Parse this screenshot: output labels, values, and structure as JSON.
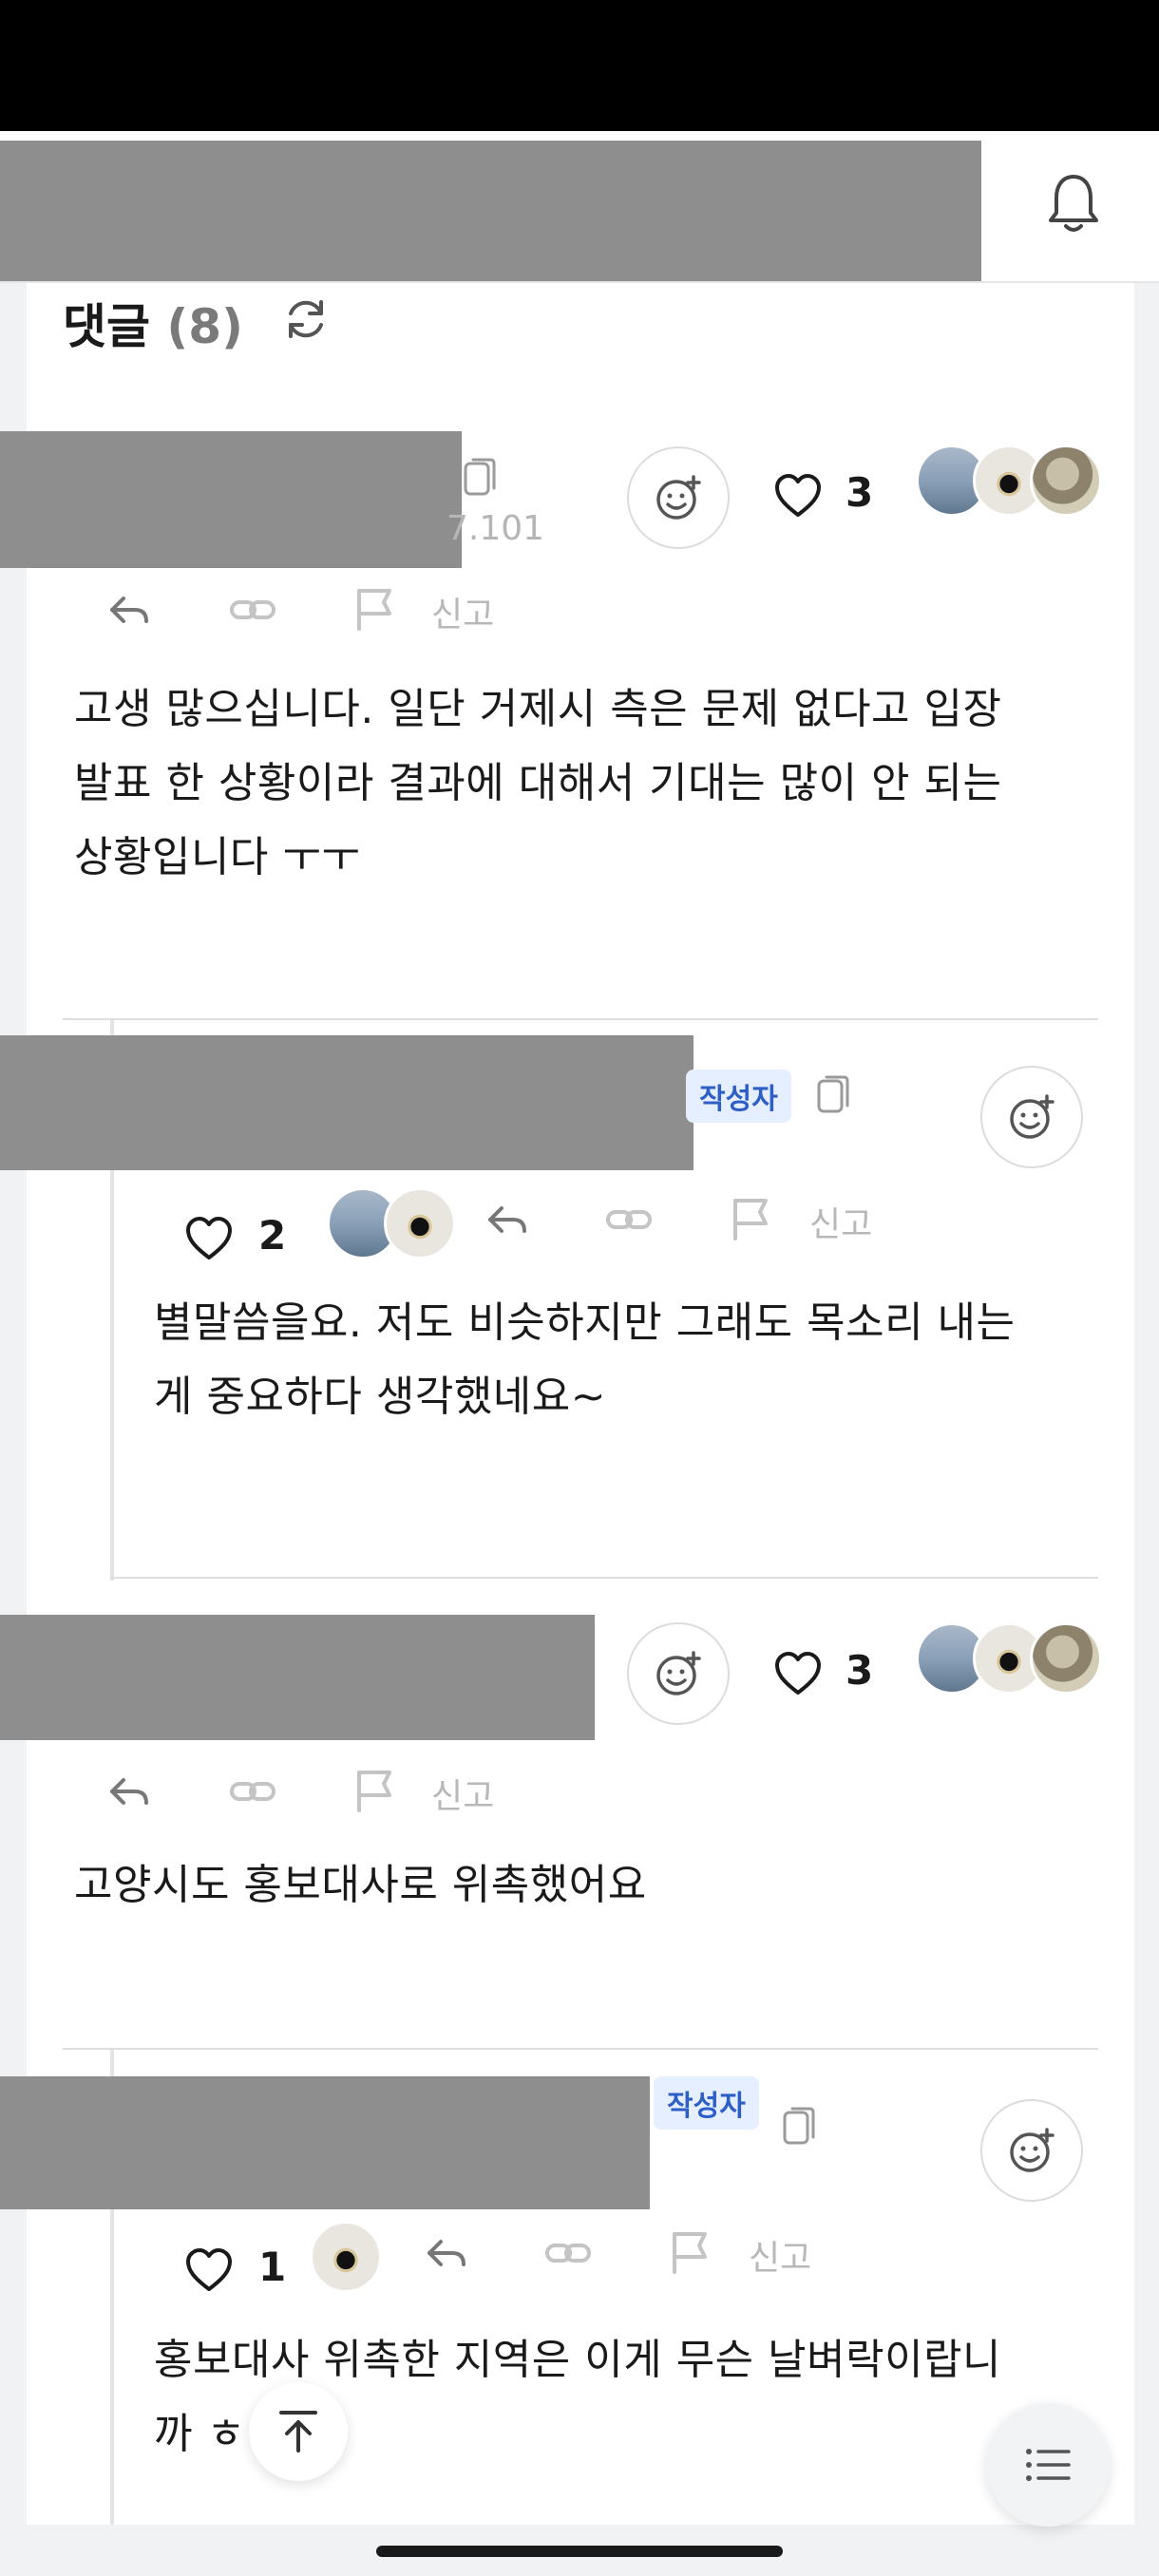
{
  "comments_header": {
    "title": "댓글",
    "count": "(8)"
  },
  "action_labels": {
    "report": "신고"
  },
  "author_badge": "작성자",
  "comments": [
    {
      "ip_fragment": "7.101",
      "likes": "3",
      "text_lines": [
        "고생 많으십니다. 일단 거제시 측은 문제 없다고 입장",
        "발표 한 상황이라 결과에 대해서 기대는 많이 안 되는",
        "상황입니다 ㅜㅜ"
      ]
    },
    {
      "likes": "2",
      "text_lines": [
        "별말씀을요. 저도 비슷하지만 그래도 목소리 내는",
        "게 중요하다 생각했네요~"
      ]
    },
    {
      "likes": "3",
      "text_lines": [
        "고양시도 홍보대사로 위촉했어요"
      ]
    },
    {
      "likes": "1",
      "text_lines": [
        "홍보대사 위촉한 지역은 이게 무슨 날벼락이랍니",
        "까 ㅎ"
      ]
    }
  ],
  "icons": [
    "bell-icon",
    "refresh-icon",
    "copy-icon",
    "emoji-add-icon",
    "heart-icon",
    "reply-icon",
    "link-icon",
    "flag-icon",
    "scroll-top-icon",
    "list-icon"
  ]
}
